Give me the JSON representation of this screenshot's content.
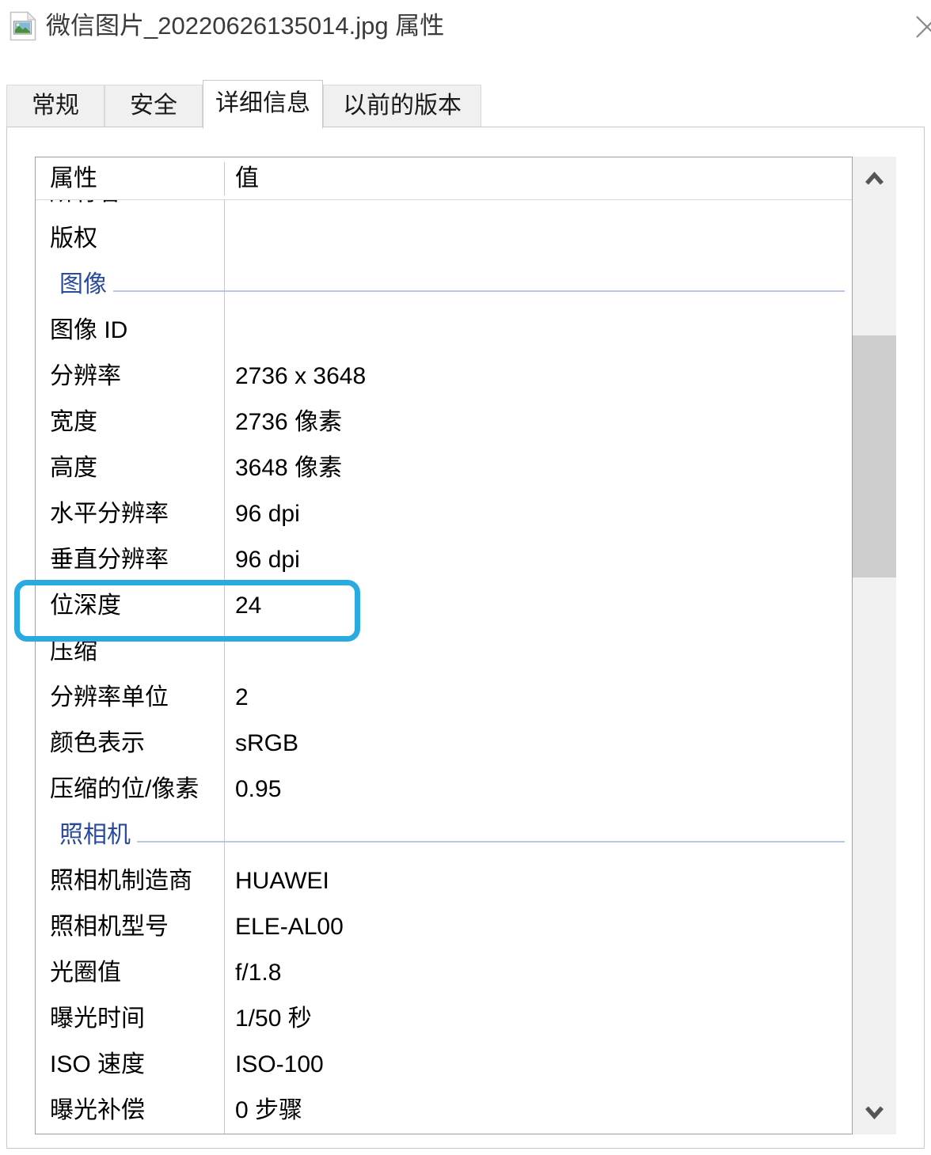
{
  "window": {
    "title": "微信图片_20220626135014.jpg 属性",
    "file_icon": "image-file-icon",
    "close_icon": "close-icon"
  },
  "tabs": [
    {
      "label": "常规",
      "active": false
    },
    {
      "label": "安全",
      "active": false
    },
    {
      "label": "详细信息",
      "active": true
    },
    {
      "label": "以前的版本",
      "active": false
    }
  ],
  "list": {
    "headers": {
      "property": "属性",
      "value": "值"
    },
    "rows": [
      {
        "type": "clipped",
        "name": "所有者",
        "value": ""
      },
      {
        "type": "item",
        "name": "版权",
        "value": ""
      },
      {
        "type": "section",
        "name": "图像",
        "value": ""
      },
      {
        "type": "item",
        "name": "图像 ID",
        "value": ""
      },
      {
        "type": "item",
        "name": "分辨率",
        "value": "2736 x 3648"
      },
      {
        "type": "item",
        "name": "宽度",
        "value": "2736 像素"
      },
      {
        "type": "item",
        "name": "高度",
        "value": "3648 像素"
      },
      {
        "type": "item",
        "name": "水平分辨率",
        "value": "96 dpi"
      },
      {
        "type": "item",
        "name": "垂直分辨率",
        "value": "96 dpi"
      },
      {
        "type": "item",
        "name": "位深度",
        "value": "24"
      },
      {
        "type": "item",
        "name": "压缩",
        "value": ""
      },
      {
        "type": "item",
        "name": "分辨率单位",
        "value": "2"
      },
      {
        "type": "item",
        "name": "颜色表示",
        "value": "sRGB"
      },
      {
        "type": "item",
        "name": "压缩的位/像素",
        "value": "0.95"
      },
      {
        "type": "section",
        "name": "照相机",
        "value": ""
      },
      {
        "type": "item",
        "name": "照相机制造商",
        "value": "HUAWEI"
      },
      {
        "type": "item",
        "name": "照相机型号",
        "value": "ELE-AL00"
      },
      {
        "type": "item",
        "name": "光圈值",
        "value": "f/1.8"
      },
      {
        "type": "item",
        "name": "曝光时间",
        "value": "1/50 秒"
      },
      {
        "type": "item",
        "name": "ISO 速度",
        "value": "ISO-100"
      },
      {
        "type": "item",
        "name": "曝光补偿",
        "value": "0 步骤"
      }
    ]
  },
  "annotation": {
    "highlight_color": "#29abe2",
    "highlighted_row_name": "位深度",
    "highlighted_row_value": "24"
  },
  "scrollbar": {
    "up_icon": "chevron-up-icon",
    "down_icon": "chevron-down-icon",
    "thumb_icon": "scrollbar-thumb"
  },
  "colors": {
    "section_text": "#2a4b9b",
    "section_rule": "#b9c6e4",
    "title_text": "#3a3a3a",
    "tab_inactive_bg": "#f0f0f0",
    "tab_active_bg": "#ffffff"
  }
}
